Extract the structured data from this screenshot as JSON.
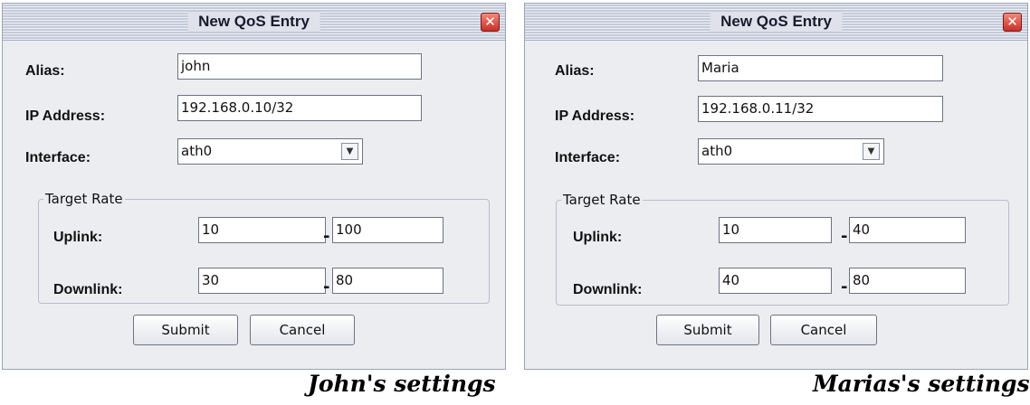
{
  "dialogs": [
    {
      "title": "New QoS Entry",
      "close_glyph": "✕",
      "alias_label": "Alias:",
      "alias_value": "john",
      "ip_label": "IP Address:",
      "ip_value": "192.168.0.10/32",
      "interface_label": "Interface:",
      "interface_value": "ath0",
      "target_rate_label": "Target Rate",
      "uplink_label": "Uplink:",
      "uplink_min": "10",
      "uplink_max": "100",
      "downlink_label": "Downlink:",
      "downlink_min": "30",
      "downlink_max": "80",
      "range_separator": "-",
      "submit_label": "Submit",
      "cancel_label": "Cancel"
    },
    {
      "title": "New QoS Entry",
      "close_glyph": "✕",
      "alias_label": "Alias:",
      "alias_value": "Maria",
      "ip_label": "IP Address:",
      "ip_value": "192.168.0.11/32",
      "interface_label": "Interface:",
      "interface_value": "ath0",
      "target_rate_label": "Target Rate",
      "uplink_label": "Uplink:",
      "uplink_min": "10",
      "uplink_max": "40",
      "downlink_label": "Downlink:",
      "downlink_min": "40",
      "downlink_max": "80",
      "range_separator": "-",
      "submit_label": "Submit",
      "cancel_label": "Cancel"
    }
  ],
  "captions": {
    "left": "John's settings",
    "right": "Marias's settings"
  },
  "icons": {
    "close": "close-icon",
    "dropdown": "chevron-down-icon"
  },
  "colors": {
    "close_button": "#c9302a",
    "dialog_background": "#ecedf1"
  }
}
